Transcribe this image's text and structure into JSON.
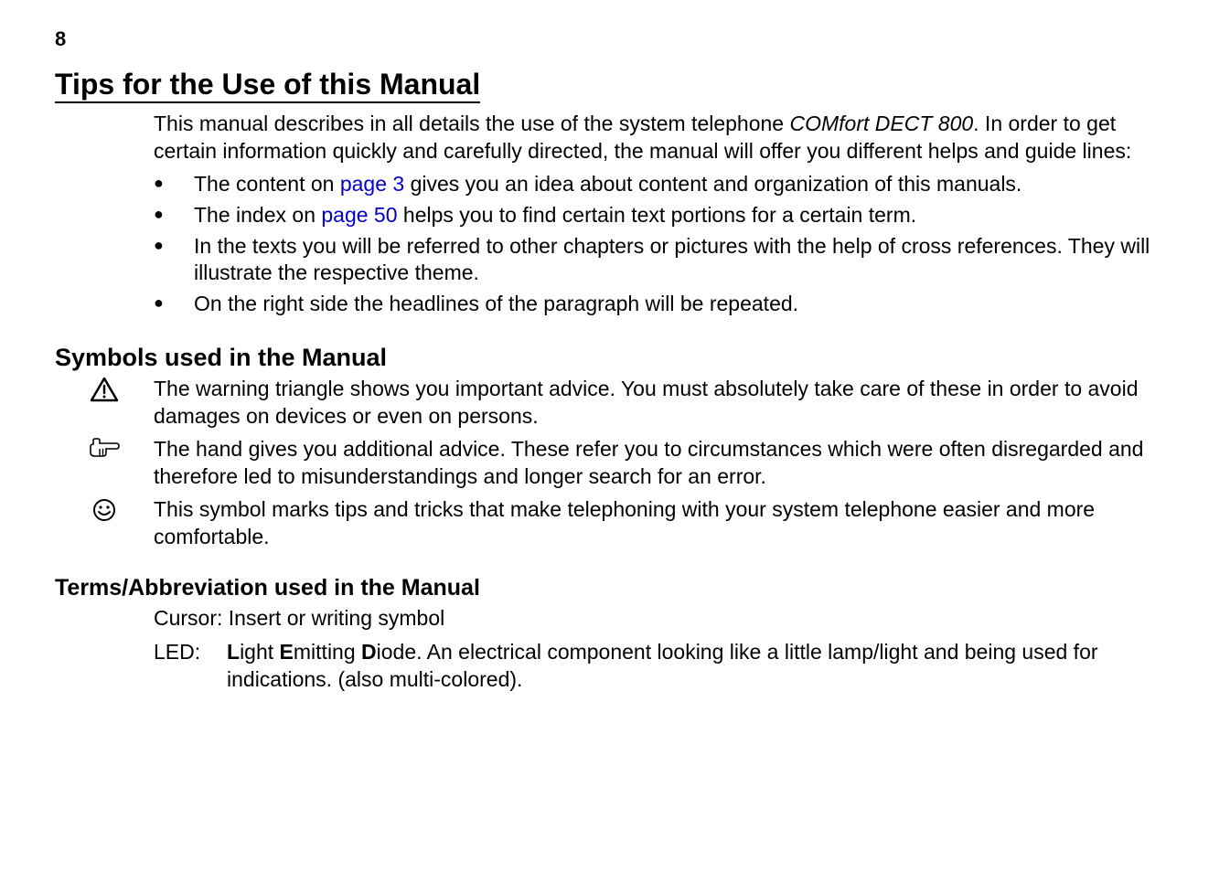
{
  "page_number": "8",
  "h1": "Tips for the Use of this Manual",
  "intro_pre": "This manual describes in all details the use of the system telephone ",
  "intro_italic": "COMfort DECT 800",
  "intro_post": ". In order to get certain information quickly and carefully directed, the manual will offer you different helps and guide lines:",
  "bullets": {
    "b1_pre": "The content on ",
    "b1_link": "page 3",
    "b1_post": " gives you an idea about content and organization of this manuals.",
    "b2_pre": "The index on ",
    "b2_link": "page 50",
    "b2_post": " helps you to find certain text portions for a certain term.",
    "b3": "In the texts you will be referred to other chapters or pictures with the help of cross references. They will illustrate the respective theme.",
    "b4": "On the right side the headlines of the paragraph will be repeated."
  },
  "h2_symbols": "Symbols used in the Manual",
  "symbols": {
    "warning": "The warning triangle shows you important advice. You must absolutely take care of these in order to avoid damages on devices or even on persons.",
    "hand": "The hand gives you additional advice. These refer you to circumstances which were often disregarded and therefore led to misunderstandings and longer search for an error.",
    "smiley": "This symbol marks tips and tricks that make telephoning with your system telephone easier and more comfortable."
  },
  "h3_terms": "Terms/Abbreviation used in the Manual",
  "cursor_line": "Cursor: Insert or writing symbol",
  "led": {
    "term": "LED:",
    "pre": "",
    "L": "L",
    "mid1": "ight ",
    "E": "E",
    "mid2": "mitting ",
    "D": "D",
    "post": "iode. An electrical component looking like a little lamp/light and being used for indications. (also multi-colored)."
  }
}
